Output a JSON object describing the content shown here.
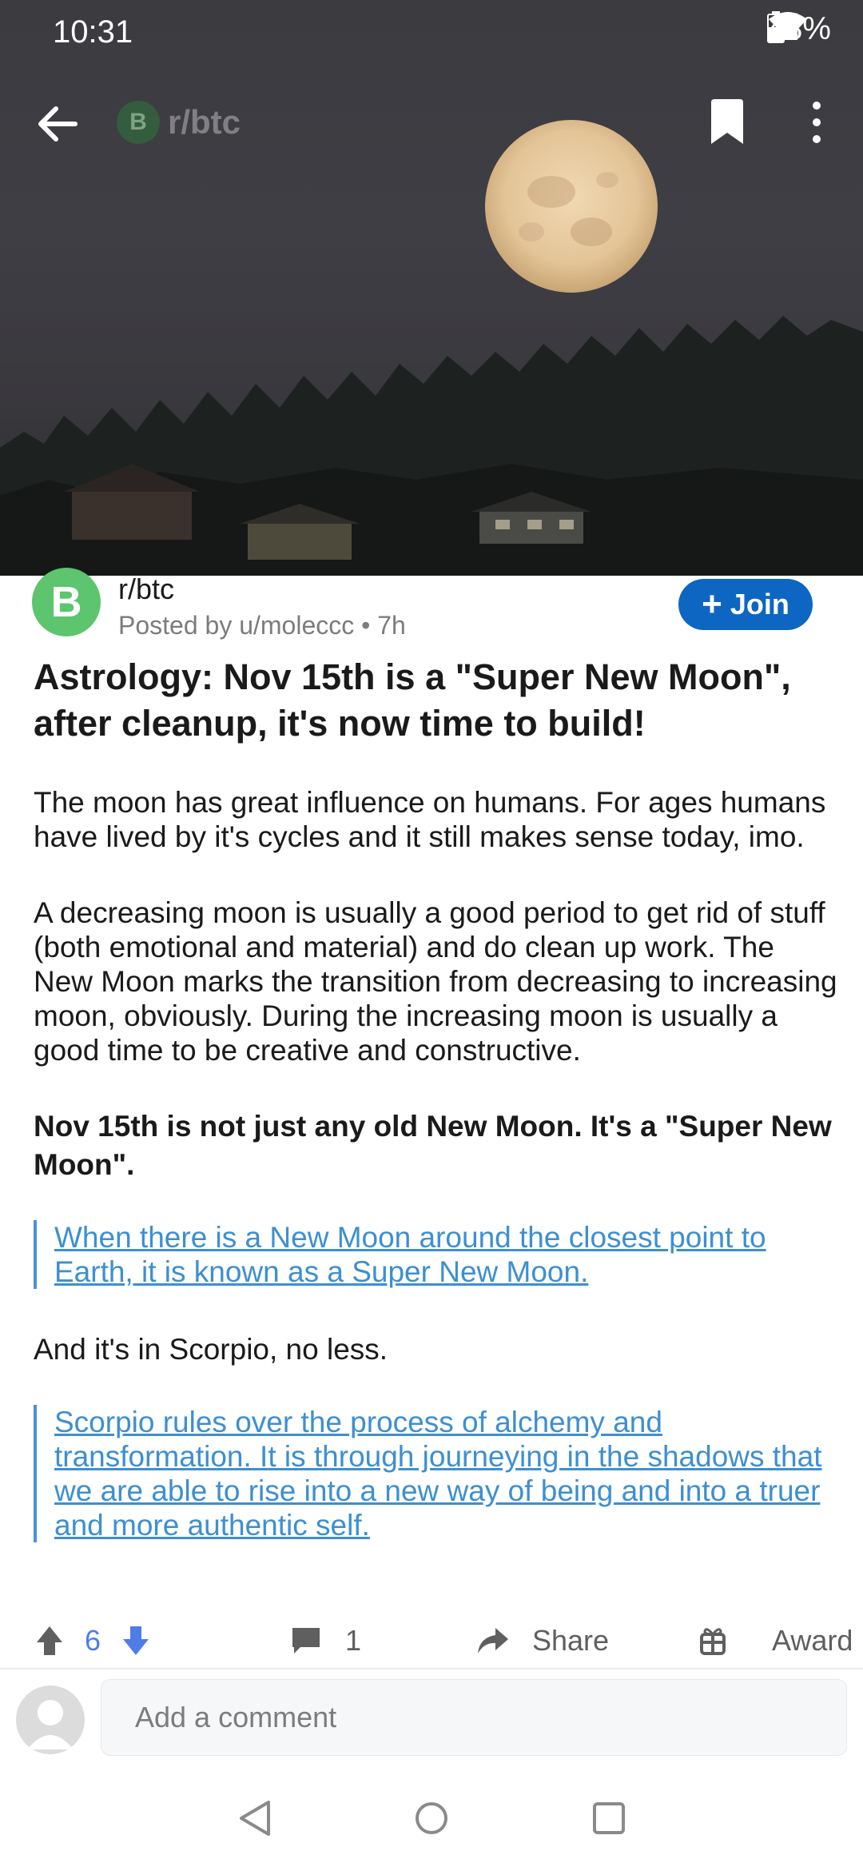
{
  "status_bar": {
    "time": "10:31",
    "battery": "48%"
  },
  "top_nav": {
    "subreddit": "r/btc",
    "avatar_glyph": "B"
  },
  "post": {
    "subreddit": "r/btc",
    "subreddit_icon_glyph": "B",
    "posted_by": "Posted by u/moleccc • 7h",
    "join_label": "Join",
    "join_icon": "+",
    "title": "Astrology: Nov 15th is a \"Super New Moon\", after cleanup, it's now time to build!",
    "paragraph_1": "The moon has great influence on humans. For ages humans have lived by it's cycles and it still makes sense today, imo.",
    "paragraph_2": "A decreasing moon is usually a good period to get rid of stuff (both emotional and material) and do clean up work. The New Moon marks the transition from decreasing to increasing moon, obviously. During the increasing moon is usually a good time to be creative and constructive.",
    "paragraph_3": "Nov 15th is not just any old New Moon. It's a \"Super New Moon\".",
    "quote_1": "When there is a New Moon around the closest point to Earth, it is known as a Super New Moon.",
    "paragraph_4": "And it's in Scorpio, no less.",
    "quote_2": "Scorpio rules over the process of alchemy and transformation. It is through journeying in the shadows that we are able to rise into a new way of being and into a truer and more authentic self."
  },
  "actions": {
    "votes": "6",
    "comments": "1",
    "share_label": "Share",
    "award_label": "Award"
  },
  "comment_box": {
    "placeholder": "Add a comment"
  },
  "colors": {
    "join_button": "#0d66c2",
    "subreddit_icon": "#5cc56e",
    "link": "#3d8fd1",
    "vote_count": "#4f7de8"
  }
}
